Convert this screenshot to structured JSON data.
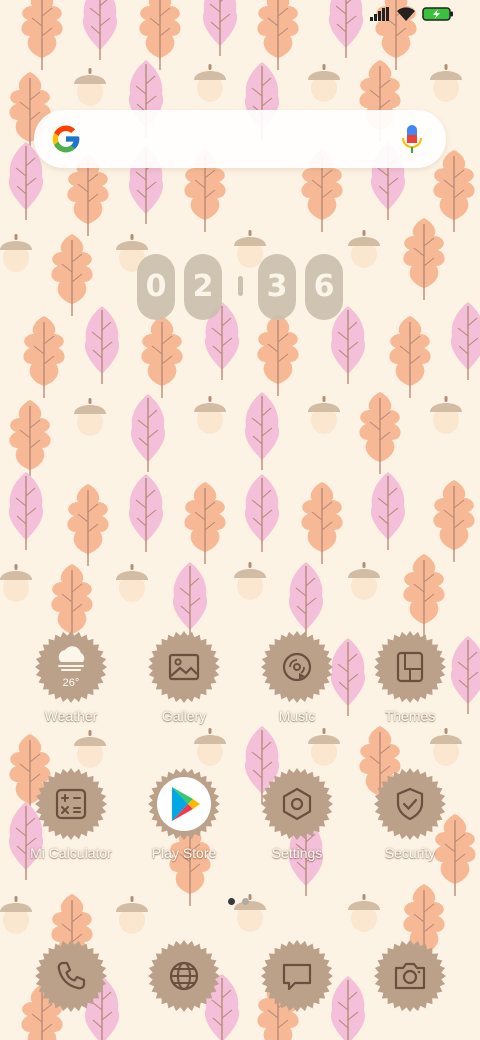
{
  "status_bar": {
    "icons": [
      "signal-icon",
      "wifi-icon",
      "battery-charging-icon"
    ],
    "battery_color": "#3cc13c"
  },
  "search": {
    "logo": "google-g-icon",
    "mic": "mic-icon"
  },
  "clock": {
    "d1": "0",
    "d2": "2",
    "d3": "3",
    "d4": "6"
  },
  "weather": {
    "temp": "26°"
  },
  "apps": {
    "weather": {
      "label": "Weather",
      "icon": "cloud-icon"
    },
    "gallery": {
      "label": "Gallery",
      "icon": "image-icon"
    },
    "music": {
      "label": "Music",
      "icon": "music-disc-icon"
    },
    "themes": {
      "label": "Themes",
      "icon": "themes-icon"
    },
    "calculator": {
      "label": "Mi Calculator",
      "icon": "calculator-icon"
    },
    "playstore": {
      "label": "Play Store",
      "icon": "play-store-icon"
    },
    "settings": {
      "label": "Settings",
      "icon": "hexagon-settings-icon"
    },
    "security": {
      "label": "Security",
      "icon": "shield-check-icon"
    }
  },
  "page_indicator": {
    "pages": 2,
    "current": 1
  },
  "dock": [
    "phone-icon",
    "browser-globe-icon",
    "messages-icon",
    "camera-icon"
  ],
  "colors": {
    "badge": "#bba08a",
    "glyph": "#6b4f3f",
    "background": "#fdf3e4",
    "leaf_orange": "#f7b995",
    "leaf_pink": "#f3bfd9",
    "acorn": "#d3bca4"
  }
}
